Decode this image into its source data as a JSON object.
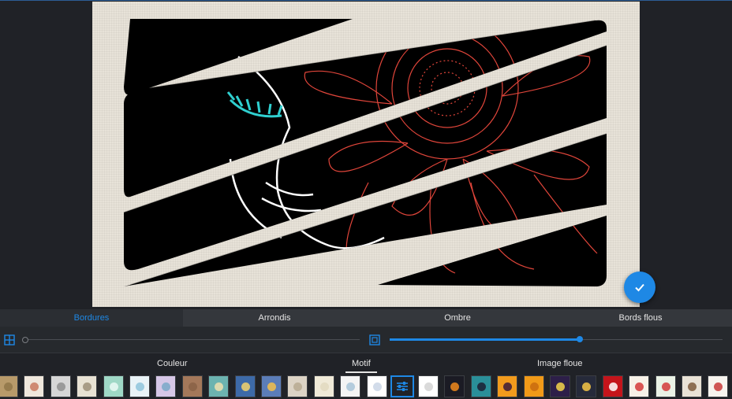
{
  "tabs": [
    {
      "label": "Bordures",
      "active": true
    },
    {
      "label": "Arrondis",
      "active": false
    },
    {
      "label": "Ombre",
      "active": false
    },
    {
      "label": "Bords flous",
      "active": false
    }
  ],
  "sliders": {
    "border_width_value": 0.0,
    "border_spacing_value": 0.57
  },
  "subtabs": [
    {
      "label": "Couleur",
      "active": false
    },
    {
      "label": "Motif",
      "active": true
    },
    {
      "label": "Image floue",
      "active": false
    }
  ],
  "icons": {
    "confirm": "check-icon",
    "border_width": "grid-icon",
    "border_spacing": "frame-icon",
    "pattern_settings": "sliders-icon"
  },
  "colors": {
    "accent": "#1e88e5",
    "background": "#1f2126",
    "canvas": "#e7e2d8",
    "artwork_line": "#e0453a",
    "eyelash": "#2fd0d0"
  },
  "patterns": [
    {
      "name": "burlap",
      "bg": "#b89a6a",
      "fg": "#8f7548"
    },
    {
      "name": "dots-cream",
      "bg": "#efe7dc",
      "fg": "#c9795f"
    },
    {
      "name": "lace-gray",
      "bg": "#d6d6d6",
      "fg": "#8f8f8f"
    },
    {
      "name": "paisley",
      "bg": "#e8e2d4",
      "fg": "#9c8f79"
    },
    {
      "name": "chevron-mint",
      "bg": "#9fd8c6",
      "fg": "#eafaf4"
    },
    {
      "name": "circles-blue",
      "bg": "#e9f3f7",
      "fg": "#8fc4dc"
    },
    {
      "name": "patchwork",
      "bg": "#d6c7e7",
      "fg": "#7aa8c8"
    },
    {
      "name": "wood-brown",
      "bg": "#a4785a",
      "fg": "#8a6147"
    },
    {
      "name": "teal-pattern",
      "bg": "#6cb3b0",
      "fg": "#f0e0b0"
    },
    {
      "name": "stripes-blue-yellow",
      "bg": "#3d6aa8",
      "fg": "#f3d36c"
    },
    {
      "name": "diagonal-blue",
      "bg": "#5b7db8",
      "fg": "#f5c04a"
    },
    {
      "name": "plaid-beige",
      "bg": "#dcd3c5",
      "fg": "#b7a990"
    },
    {
      "name": "linen-cream",
      "bg": "#f0ead8",
      "fg": "#e2d9c0"
    },
    {
      "name": "doodle-white",
      "bg": "#f4f4f4",
      "fg": "#a8c4d8"
    },
    {
      "name": "grid-white",
      "bg": "#ffffff",
      "fg": "#cad6e6"
    },
    {
      "name": "dots-white",
      "bg": "#ffffff",
      "fg": "#d3d3d3"
    },
    {
      "name": "halloween-pumpkin",
      "bg": "#1b1b24",
      "fg": "#f08a1c"
    },
    {
      "name": "bat-teal",
      "bg": "#2a8f99",
      "fg": "#1b1f33"
    },
    {
      "name": "bat-orange",
      "bg": "#f29b1d",
      "fg": "#3a1a3a"
    },
    {
      "name": "orange-spooky",
      "bg": "#f19a18",
      "fg": "#c96b0f"
    },
    {
      "name": "monster-purple",
      "bg": "#2d1f49",
      "fg": "#f4d34a"
    },
    {
      "name": "eyes-dark",
      "bg": "#262a3a",
      "fg": "#f7c646"
    },
    {
      "name": "xmas-trees-red",
      "bg": "#c4141b",
      "fg": "#ffffff"
    },
    {
      "name": "happy-christmas",
      "bg": "#f7f1e8",
      "fg": "#d33a3a"
    },
    {
      "name": "santa",
      "bg": "#eaf2e6",
      "fg": "#d33a3a"
    },
    {
      "name": "reindeer",
      "bg": "#e9e2d6",
      "fg": "#7e5a3c"
    },
    {
      "name": "candy-cane",
      "bg": "#f7f4ef",
      "fg": "#c83a3a"
    },
    {
      "name": "xmas-tree-mint",
      "bg": "#cfe7df",
      "fg": "#5fa58f"
    }
  ]
}
